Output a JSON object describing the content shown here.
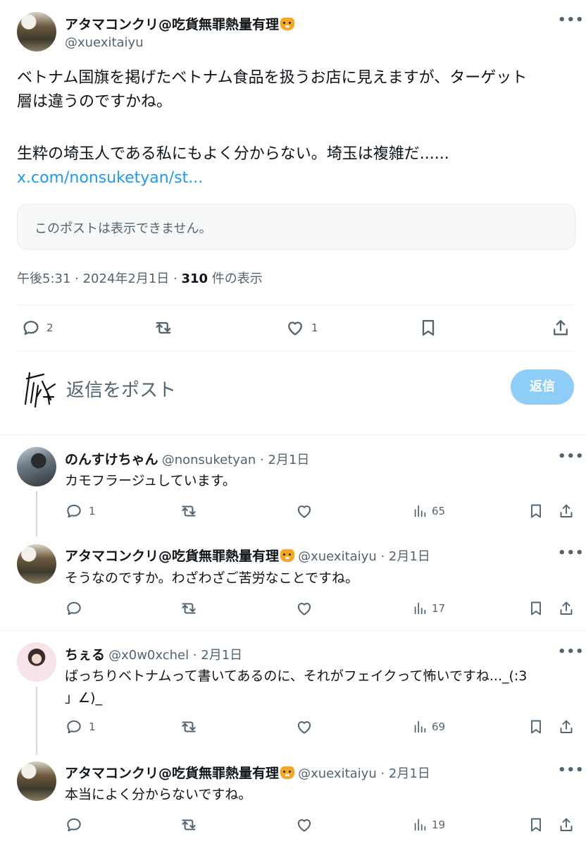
{
  "main_tweet": {
    "author_name": "アタマコンクリ@吃貨無罪熱量有理",
    "author_handle": "@xuexitaiyu",
    "text_line1": "ベトナム国旗を掲げたベトナム食品を扱うお店に見えますが、ターゲット",
    "text_line2": "層は違うのですかね。",
    "text_line3": "生粋の埼玉人である私にもよく分からない。埼玉は複雑だ......",
    "link": "x.com/nonsuketyan/st...",
    "quote_unavailable": "このポストは表示できません。",
    "time": "午後5:31 · 2024年2月1日 · ",
    "views_count": "310",
    "views_label": " 件の表示",
    "reply_count": "2",
    "like_count": "1"
  },
  "compose": {
    "placeholder": "返信をポスト",
    "button_label": "返信"
  },
  "replies": [
    {
      "name": "のんすけちゃん",
      "handle": "@nonsuketyan · 2月1日",
      "text": "カモフラージュしています。",
      "reply_count": "1",
      "views": "65"
    },
    {
      "name": "アタマコンクリ@吃貨無罪熱量有理",
      "handle": "@xuexitaiyu · 2月1日",
      "text": "そうなのですか。わざわざご苦労なことですね。",
      "reply_count": "",
      "views": "17"
    },
    {
      "name": "ちぇる",
      "handle": "@x0w0xchel · 2月1日",
      "text_line1": "ばっちりベトナムって書いてあるのに、それがフェイクって怖いですね..._(:3",
      "text_line2": "」∠)_",
      "reply_count": "1",
      "views": "69"
    },
    {
      "name": "アタマコンクリ@吃貨無罪熱量有理",
      "handle": "@xuexitaiyu · 2月1日",
      "text": "本当によく分からないですね。",
      "reply_count": "",
      "views": "19"
    }
  ],
  "colors": {
    "link": "#1d9bf0",
    "button_disabled": "#8ecdf8",
    "secondary_text": "#536471"
  }
}
